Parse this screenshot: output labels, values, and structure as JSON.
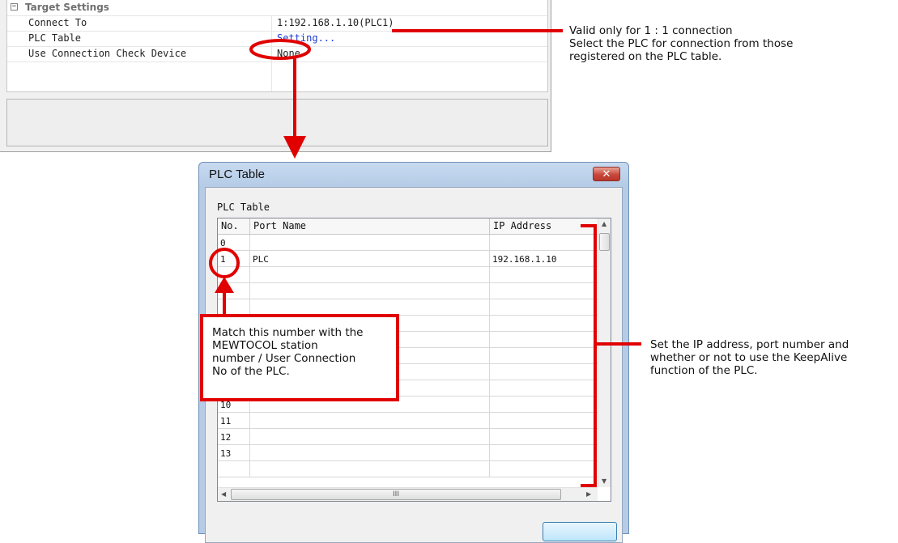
{
  "properties": {
    "category": "Target Settings",
    "rows": [
      {
        "label": "Connect To",
        "value": "1:192.168.1.10(PLC1)"
      },
      {
        "label": "PLC Table",
        "value": "Setting..."
      },
      {
        "label": "Use Connection Check Device",
        "value": "None"
      }
    ]
  },
  "dialog": {
    "title": "PLC Table",
    "close_glyph": "✕",
    "table_caption": "PLC Table",
    "columns": [
      "No.",
      "Port Name",
      "IP Address"
    ],
    "rows": [
      {
        "no": "0",
        "port": "",
        "ip": ""
      },
      {
        "no": "1",
        "port": "PLC",
        "ip": "192.168.1.10"
      },
      {
        "no": "",
        "port": "",
        "ip": ""
      },
      {
        "no": "",
        "port": "",
        "ip": ""
      },
      {
        "no": "",
        "port": "",
        "ip": ""
      },
      {
        "no": "",
        "port": "",
        "ip": ""
      },
      {
        "no": "",
        "port": "",
        "ip": ""
      },
      {
        "no": "",
        "port": "",
        "ip": ""
      },
      {
        "no": "",
        "port": "",
        "ip": ""
      },
      {
        "no": "",
        "port": "",
        "ip": ""
      },
      {
        "no": "10",
        "port": "",
        "ip": ""
      },
      {
        "no": "11",
        "port": "",
        "ip": ""
      },
      {
        "no": "12",
        "port": "",
        "ip": ""
      },
      {
        "no": "13",
        "port": "",
        "ip": ""
      },
      {
        "no": "",
        "port": "",
        "ip": ""
      }
    ],
    "hscroll_grip": "III"
  },
  "annotations": {
    "top_note": [
      "Valid only for 1 : 1 connection",
      "Select the PLC for connection from those",
      "registered on the PLC table."
    ],
    "callout": [
      "Match this number with the",
      "MEWTOCOL station",
      "number / User Connection",
      "No of the PLC."
    ],
    "side_note": [
      "Set the IP address, port number and",
      "whether or not to use the KeepAlive",
      "function of the PLC."
    ],
    "accent_color": "#e00000"
  }
}
